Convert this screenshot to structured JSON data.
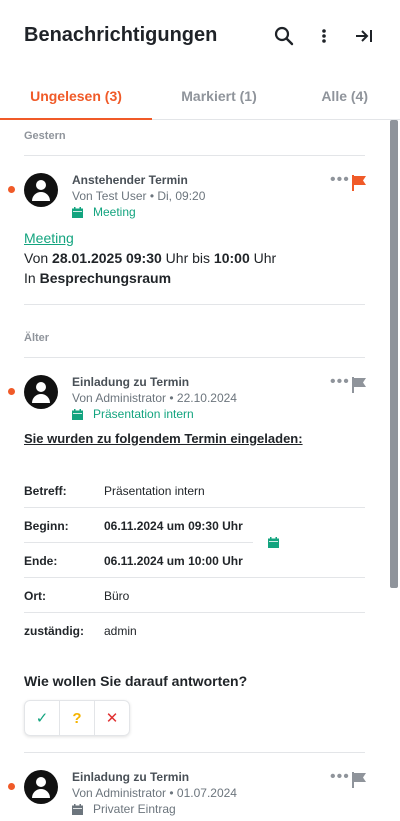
{
  "header": {
    "title": "Benachrichtigungen",
    "icons": [
      "search-icon",
      "more-vertical-icon",
      "collapse-panel-icon"
    ]
  },
  "tabs": [
    {
      "label": "Ungelesen (3)",
      "active": true
    },
    {
      "label": "Markiert (1)",
      "active": false
    },
    {
      "label": "Alle (4)",
      "active": false
    }
  ],
  "colors": {
    "accent": "#f05a28",
    "green": "#13a47f",
    "muted": "#8f949b"
  },
  "sections": {
    "yesterday": "Gestern",
    "older": "Älter"
  },
  "notifications": [
    {
      "title": "Anstehender Termin",
      "sub": "Von Test User • Di, 09:20",
      "tag": "Meeting",
      "flagged": true,
      "body": {
        "link": "Meeting",
        "from_prefix": "Von ",
        "from_date": "28.01.2025 09:30",
        "from_mid": " Uhr bis ",
        "to_time": "10:00",
        "to_suffix": " Uhr",
        "place_prefix": "In ",
        "place": "Besprechungsraum"
      }
    },
    {
      "title": "Einladung zu Termin",
      "sub": "Von Administrator • 22.10.2024",
      "tag": "Präsentation intern",
      "flagged": false,
      "invite": {
        "heading": "Sie wurden zu folgendem Termin eingeladen:",
        "rows": [
          {
            "label": "Betreff:",
            "value": "Präsentation intern"
          },
          {
            "label": "Beginn:",
            "value": "06.11.2024 um 09:30 Uhr"
          },
          {
            "label": "Ende:",
            "value": "06.11.2024 um 10:00 Uhr"
          },
          {
            "label": "Ort:",
            "value": "Büro"
          },
          {
            "label": "zuständig:",
            "value": "admin"
          }
        ],
        "question": "Wie wollen Sie darauf antworten?",
        "answers": [
          "✓",
          "?",
          "✕"
        ]
      }
    },
    {
      "title": "Einladung zu Termin",
      "sub": "Von Administrator • 01.07.2024",
      "tag": "Privater Eintrag",
      "flagged": false
    }
  ]
}
